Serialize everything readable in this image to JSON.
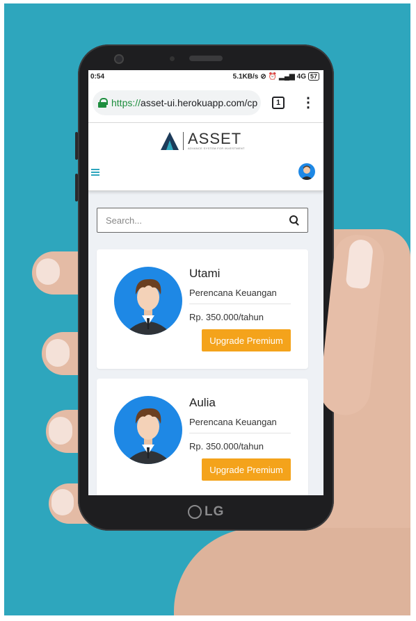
{
  "statusbar": {
    "time": "0:54",
    "speed": "5.1KB/s",
    "network": "4G",
    "battery": "57"
  },
  "browser": {
    "url_scheme": "https://",
    "url_rest": "asset-ui.herokuapp.com/cp",
    "tab_count": "1"
  },
  "app": {
    "logo_text": "ASSET",
    "logo_subtitle": "ADVANCE SYSTEM FOR INVESTMENT"
  },
  "search": {
    "placeholder": "Search..."
  },
  "planners": [
    {
      "name": "Utami",
      "role": "Perencana Keuangan",
      "price": "Rp. 350.000/tahun",
      "button": "Upgrade Premium"
    },
    {
      "name": "Aulia",
      "role": "Perencana Keuangan",
      "price": "Rp. 350.000/tahun",
      "button": "Upgrade Premium"
    }
  ],
  "device": {
    "brand": "LG"
  },
  "colors": {
    "background": "#2ea6bd",
    "accent": "#2ea6bd",
    "button": "#f4a31b",
    "avatar_bg": "#1e88e5",
    "secure_green": "#1e8e3e"
  },
  "icons": {
    "lock": "lock-icon",
    "tabs": "tabs-icon",
    "menu": "more-vert-icon",
    "hamburger": "hamburger-icon",
    "search": "search-icon"
  }
}
